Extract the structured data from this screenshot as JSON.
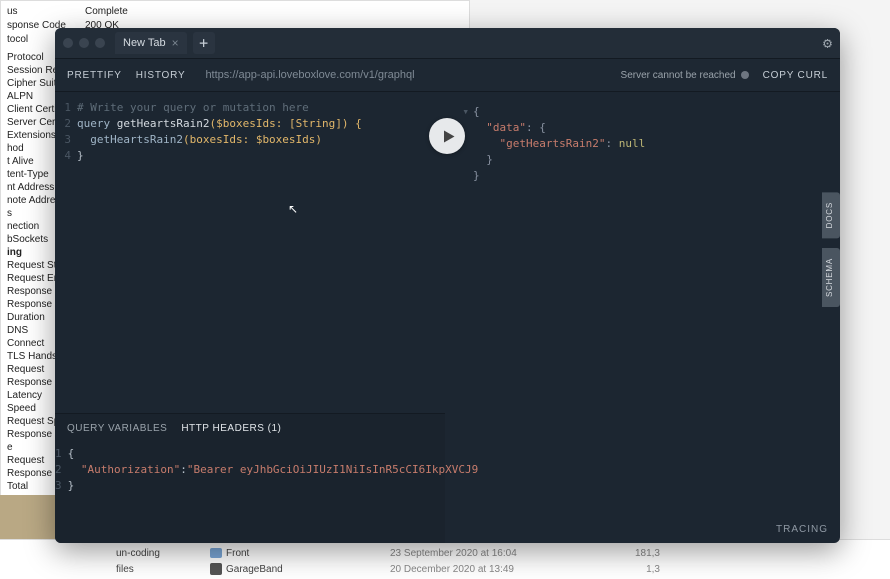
{
  "bg": {
    "top": [
      {
        "l": "us",
        "r": "Complete"
      },
      {
        "l": "sponse Code",
        "r": "200 OK"
      },
      {
        "l": "tocol",
        "r": ""
      }
    ],
    "list": [
      "Protocol",
      "Session Resum",
      "Cipher Suite",
      "ALPN",
      "Client Certifica",
      "Server Certific",
      "Extensions",
      "hod",
      "t Alive",
      "tent-Type",
      "nt Address",
      "note Address",
      "s",
      "nection",
      "bSockets",
      "ing",
      "Request Start T",
      "Request End Ti",
      "Response Start",
      "Response End T",
      "Duration",
      "DNS",
      "Connect",
      "TLS Handshake",
      "Request",
      "Response",
      "Latency",
      "Speed",
      "Request Speed",
      "Response Spe",
      "e",
      "Request",
      "Response",
      "Total"
    ],
    "bold_index": 15
  },
  "finder": {
    "rows": [
      {
        "c1": "un-coding",
        "c2": "Front",
        "c3": "23 September 2020 at 16:04",
        "c4": "181,3"
      },
      {
        "c1": "files",
        "c2": "GarageBand",
        "c3": "20 December 2020 at 13:49",
        "c4": "1,3"
      }
    ]
  },
  "win": {
    "tab_label": "New Tab",
    "prettify": "PRETTIFY",
    "history": "HISTORY",
    "url": "https://app-api.loveboxlove.com/v1/graphql",
    "status": "Server cannot be reached",
    "copy": "COPY CURL",
    "sideDocs": "DOCS",
    "sideSchema": "SCHEMA",
    "tracing": "TRACING",
    "query_lines": {
      "l1": "# Write your query or mutation here",
      "l2_kw": "query ",
      "l2_name": "getHeartsRain2",
      "l2_args": "($boxesIds: [",
      "l2_type": "String",
      "l2_args2": "]) {",
      "l3_field": "getHeartsRain2",
      "l3_args": "(boxesIds: $boxesIds)",
      "l4": "}"
    },
    "result_lines": {
      "l1": "{",
      "l2_k": "\"data\"",
      "l2_r": ": {",
      "l3_k": "\"getHeartsRain2\"",
      "l3_r": ": ",
      "l3_v": "null",
      "l4": "}",
      "l5": "}"
    },
    "vars": {
      "tab1": "QUERY VARIABLES",
      "tab2": "HTTP HEADERS (1)",
      "l1": "{",
      "l2_k": "\"Authorization\"",
      "l2_c": ":",
      "l2_v": "\"Bearer eyJhbGciOiJIUzI1NiIsInR5cCI6IkpXVCJ9",
      "l3": "}"
    }
  }
}
